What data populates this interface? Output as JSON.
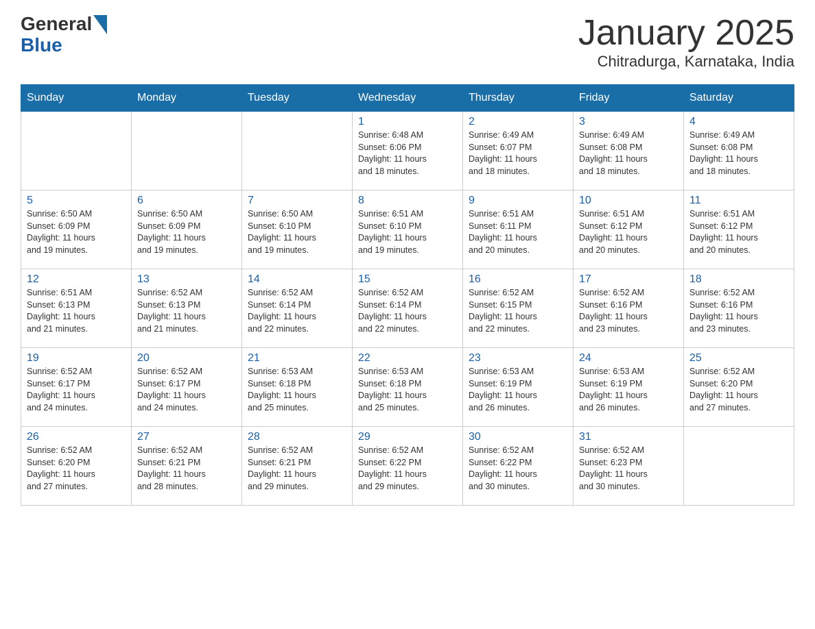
{
  "header": {
    "logo_general": "General",
    "logo_blue": "Blue",
    "month_title": "January 2025",
    "location": "Chitradurga, Karnataka, India"
  },
  "weekdays": [
    "Sunday",
    "Monday",
    "Tuesday",
    "Wednesday",
    "Thursday",
    "Friday",
    "Saturday"
  ],
  "weeks": [
    [
      {
        "day": "",
        "info": ""
      },
      {
        "day": "",
        "info": ""
      },
      {
        "day": "",
        "info": ""
      },
      {
        "day": "1",
        "info": "Sunrise: 6:48 AM\nSunset: 6:06 PM\nDaylight: 11 hours\nand 18 minutes."
      },
      {
        "day": "2",
        "info": "Sunrise: 6:49 AM\nSunset: 6:07 PM\nDaylight: 11 hours\nand 18 minutes."
      },
      {
        "day": "3",
        "info": "Sunrise: 6:49 AM\nSunset: 6:08 PM\nDaylight: 11 hours\nand 18 minutes."
      },
      {
        "day": "4",
        "info": "Sunrise: 6:49 AM\nSunset: 6:08 PM\nDaylight: 11 hours\nand 18 minutes."
      }
    ],
    [
      {
        "day": "5",
        "info": "Sunrise: 6:50 AM\nSunset: 6:09 PM\nDaylight: 11 hours\nand 19 minutes."
      },
      {
        "day": "6",
        "info": "Sunrise: 6:50 AM\nSunset: 6:09 PM\nDaylight: 11 hours\nand 19 minutes."
      },
      {
        "day": "7",
        "info": "Sunrise: 6:50 AM\nSunset: 6:10 PM\nDaylight: 11 hours\nand 19 minutes."
      },
      {
        "day": "8",
        "info": "Sunrise: 6:51 AM\nSunset: 6:10 PM\nDaylight: 11 hours\nand 19 minutes."
      },
      {
        "day": "9",
        "info": "Sunrise: 6:51 AM\nSunset: 6:11 PM\nDaylight: 11 hours\nand 20 minutes."
      },
      {
        "day": "10",
        "info": "Sunrise: 6:51 AM\nSunset: 6:12 PM\nDaylight: 11 hours\nand 20 minutes."
      },
      {
        "day": "11",
        "info": "Sunrise: 6:51 AM\nSunset: 6:12 PM\nDaylight: 11 hours\nand 20 minutes."
      }
    ],
    [
      {
        "day": "12",
        "info": "Sunrise: 6:51 AM\nSunset: 6:13 PM\nDaylight: 11 hours\nand 21 minutes."
      },
      {
        "day": "13",
        "info": "Sunrise: 6:52 AM\nSunset: 6:13 PM\nDaylight: 11 hours\nand 21 minutes."
      },
      {
        "day": "14",
        "info": "Sunrise: 6:52 AM\nSunset: 6:14 PM\nDaylight: 11 hours\nand 22 minutes."
      },
      {
        "day": "15",
        "info": "Sunrise: 6:52 AM\nSunset: 6:14 PM\nDaylight: 11 hours\nand 22 minutes."
      },
      {
        "day": "16",
        "info": "Sunrise: 6:52 AM\nSunset: 6:15 PM\nDaylight: 11 hours\nand 22 minutes."
      },
      {
        "day": "17",
        "info": "Sunrise: 6:52 AM\nSunset: 6:16 PM\nDaylight: 11 hours\nand 23 minutes."
      },
      {
        "day": "18",
        "info": "Sunrise: 6:52 AM\nSunset: 6:16 PM\nDaylight: 11 hours\nand 23 minutes."
      }
    ],
    [
      {
        "day": "19",
        "info": "Sunrise: 6:52 AM\nSunset: 6:17 PM\nDaylight: 11 hours\nand 24 minutes."
      },
      {
        "day": "20",
        "info": "Sunrise: 6:52 AM\nSunset: 6:17 PM\nDaylight: 11 hours\nand 24 minutes."
      },
      {
        "day": "21",
        "info": "Sunrise: 6:53 AM\nSunset: 6:18 PM\nDaylight: 11 hours\nand 25 minutes."
      },
      {
        "day": "22",
        "info": "Sunrise: 6:53 AM\nSunset: 6:18 PM\nDaylight: 11 hours\nand 25 minutes."
      },
      {
        "day": "23",
        "info": "Sunrise: 6:53 AM\nSunset: 6:19 PM\nDaylight: 11 hours\nand 26 minutes."
      },
      {
        "day": "24",
        "info": "Sunrise: 6:53 AM\nSunset: 6:19 PM\nDaylight: 11 hours\nand 26 minutes."
      },
      {
        "day": "25",
        "info": "Sunrise: 6:52 AM\nSunset: 6:20 PM\nDaylight: 11 hours\nand 27 minutes."
      }
    ],
    [
      {
        "day": "26",
        "info": "Sunrise: 6:52 AM\nSunset: 6:20 PM\nDaylight: 11 hours\nand 27 minutes."
      },
      {
        "day": "27",
        "info": "Sunrise: 6:52 AM\nSunset: 6:21 PM\nDaylight: 11 hours\nand 28 minutes."
      },
      {
        "day": "28",
        "info": "Sunrise: 6:52 AM\nSunset: 6:21 PM\nDaylight: 11 hours\nand 29 minutes."
      },
      {
        "day": "29",
        "info": "Sunrise: 6:52 AM\nSunset: 6:22 PM\nDaylight: 11 hours\nand 29 minutes."
      },
      {
        "day": "30",
        "info": "Sunrise: 6:52 AM\nSunset: 6:22 PM\nDaylight: 11 hours\nand 30 minutes."
      },
      {
        "day": "31",
        "info": "Sunrise: 6:52 AM\nSunset: 6:23 PM\nDaylight: 11 hours\nand 30 minutes."
      },
      {
        "day": "",
        "info": ""
      }
    ]
  ]
}
